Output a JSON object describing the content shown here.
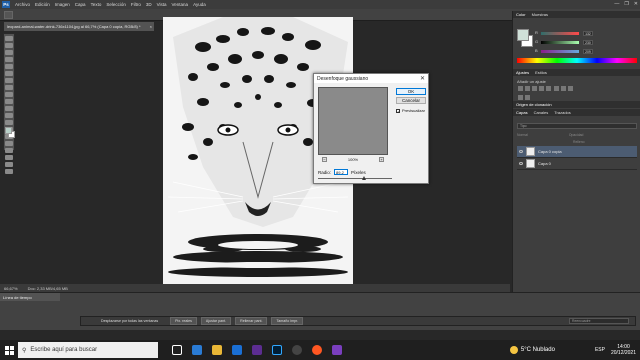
{
  "app": {
    "logo": "Ps"
  },
  "menu": [
    "Archivo",
    "Edición",
    "Imagen",
    "Capa",
    "Texto",
    "Selección",
    "Filtro",
    "3D",
    "Vista",
    "Ventana",
    "Ayuda"
  ],
  "window_controls": [
    "—",
    "❐",
    "✕"
  ],
  "document": {
    "tab_title": "leopard-animal-water-drink-736x1104.jpg al 66,7% (Capa 0 copia, RGB/8) *",
    "close": "×"
  },
  "status": {
    "zoom": "66,67%",
    "doc_size": "Doc: 2,33 MB/4,65 MB"
  },
  "right_panel": {
    "color_tabs": [
      "Color",
      "Muestras"
    ],
    "sliders": [
      {
        "label": "R",
        "value": "132"
      },
      {
        "label": "G",
        "value": "230"
      },
      {
        "label": "B",
        "value": "209"
      }
    ],
    "adjust_tabs": [
      "Ajustes",
      "Estilos"
    ],
    "adjust_label": "Añadir un ajuste",
    "source_tab": "Origen de clonación",
    "layer_tabs": [
      "Capas",
      "Canales",
      "Trazados"
    ],
    "layer_filter": "Tipo",
    "blend_mode": "Normal",
    "opacity_label": "Opacidad",
    "fill_label": "Relleno",
    "layers": [
      {
        "name": "Capa 0 copia",
        "selected": true
      },
      {
        "name": "Capa 0",
        "selected": false
      }
    ]
  },
  "dialog": {
    "title": "Desenfoque gaussiano",
    "close": "✕",
    "ok": "OK",
    "cancel": "Cancelar",
    "preview_label": "Previsualizar",
    "preview_checked": "✓",
    "zoom_value": "100%",
    "zoom_minus": "−",
    "zoom_plus": "+",
    "radius_label": "Radio:",
    "radius_value": "89,2",
    "radius_unit": "Píxeles"
  },
  "timeline": {
    "header": "Línea de tiempo",
    "scroll_label": "Desplazarse por todas las ventanas",
    "buttons": [
      "Pix. reales",
      "Ajustar pant.",
      "Rellenar pant.",
      "Tamaño impr."
    ],
    "select_placeholder": "Reencuadre"
  },
  "taskbar": {
    "search_placeholder": "Escribe aquí para buscar",
    "weather": "5°C  Nublado",
    "lang": "ESP",
    "time": "14:00",
    "date": "20/12/2021"
  },
  "colors": {
    "menubar": "#3c3c3c",
    "panel": "#3e3e3e",
    "dialog": "#f0f0f0",
    "accent": "#0078d7",
    "selected_layer": "#4c5c72"
  }
}
